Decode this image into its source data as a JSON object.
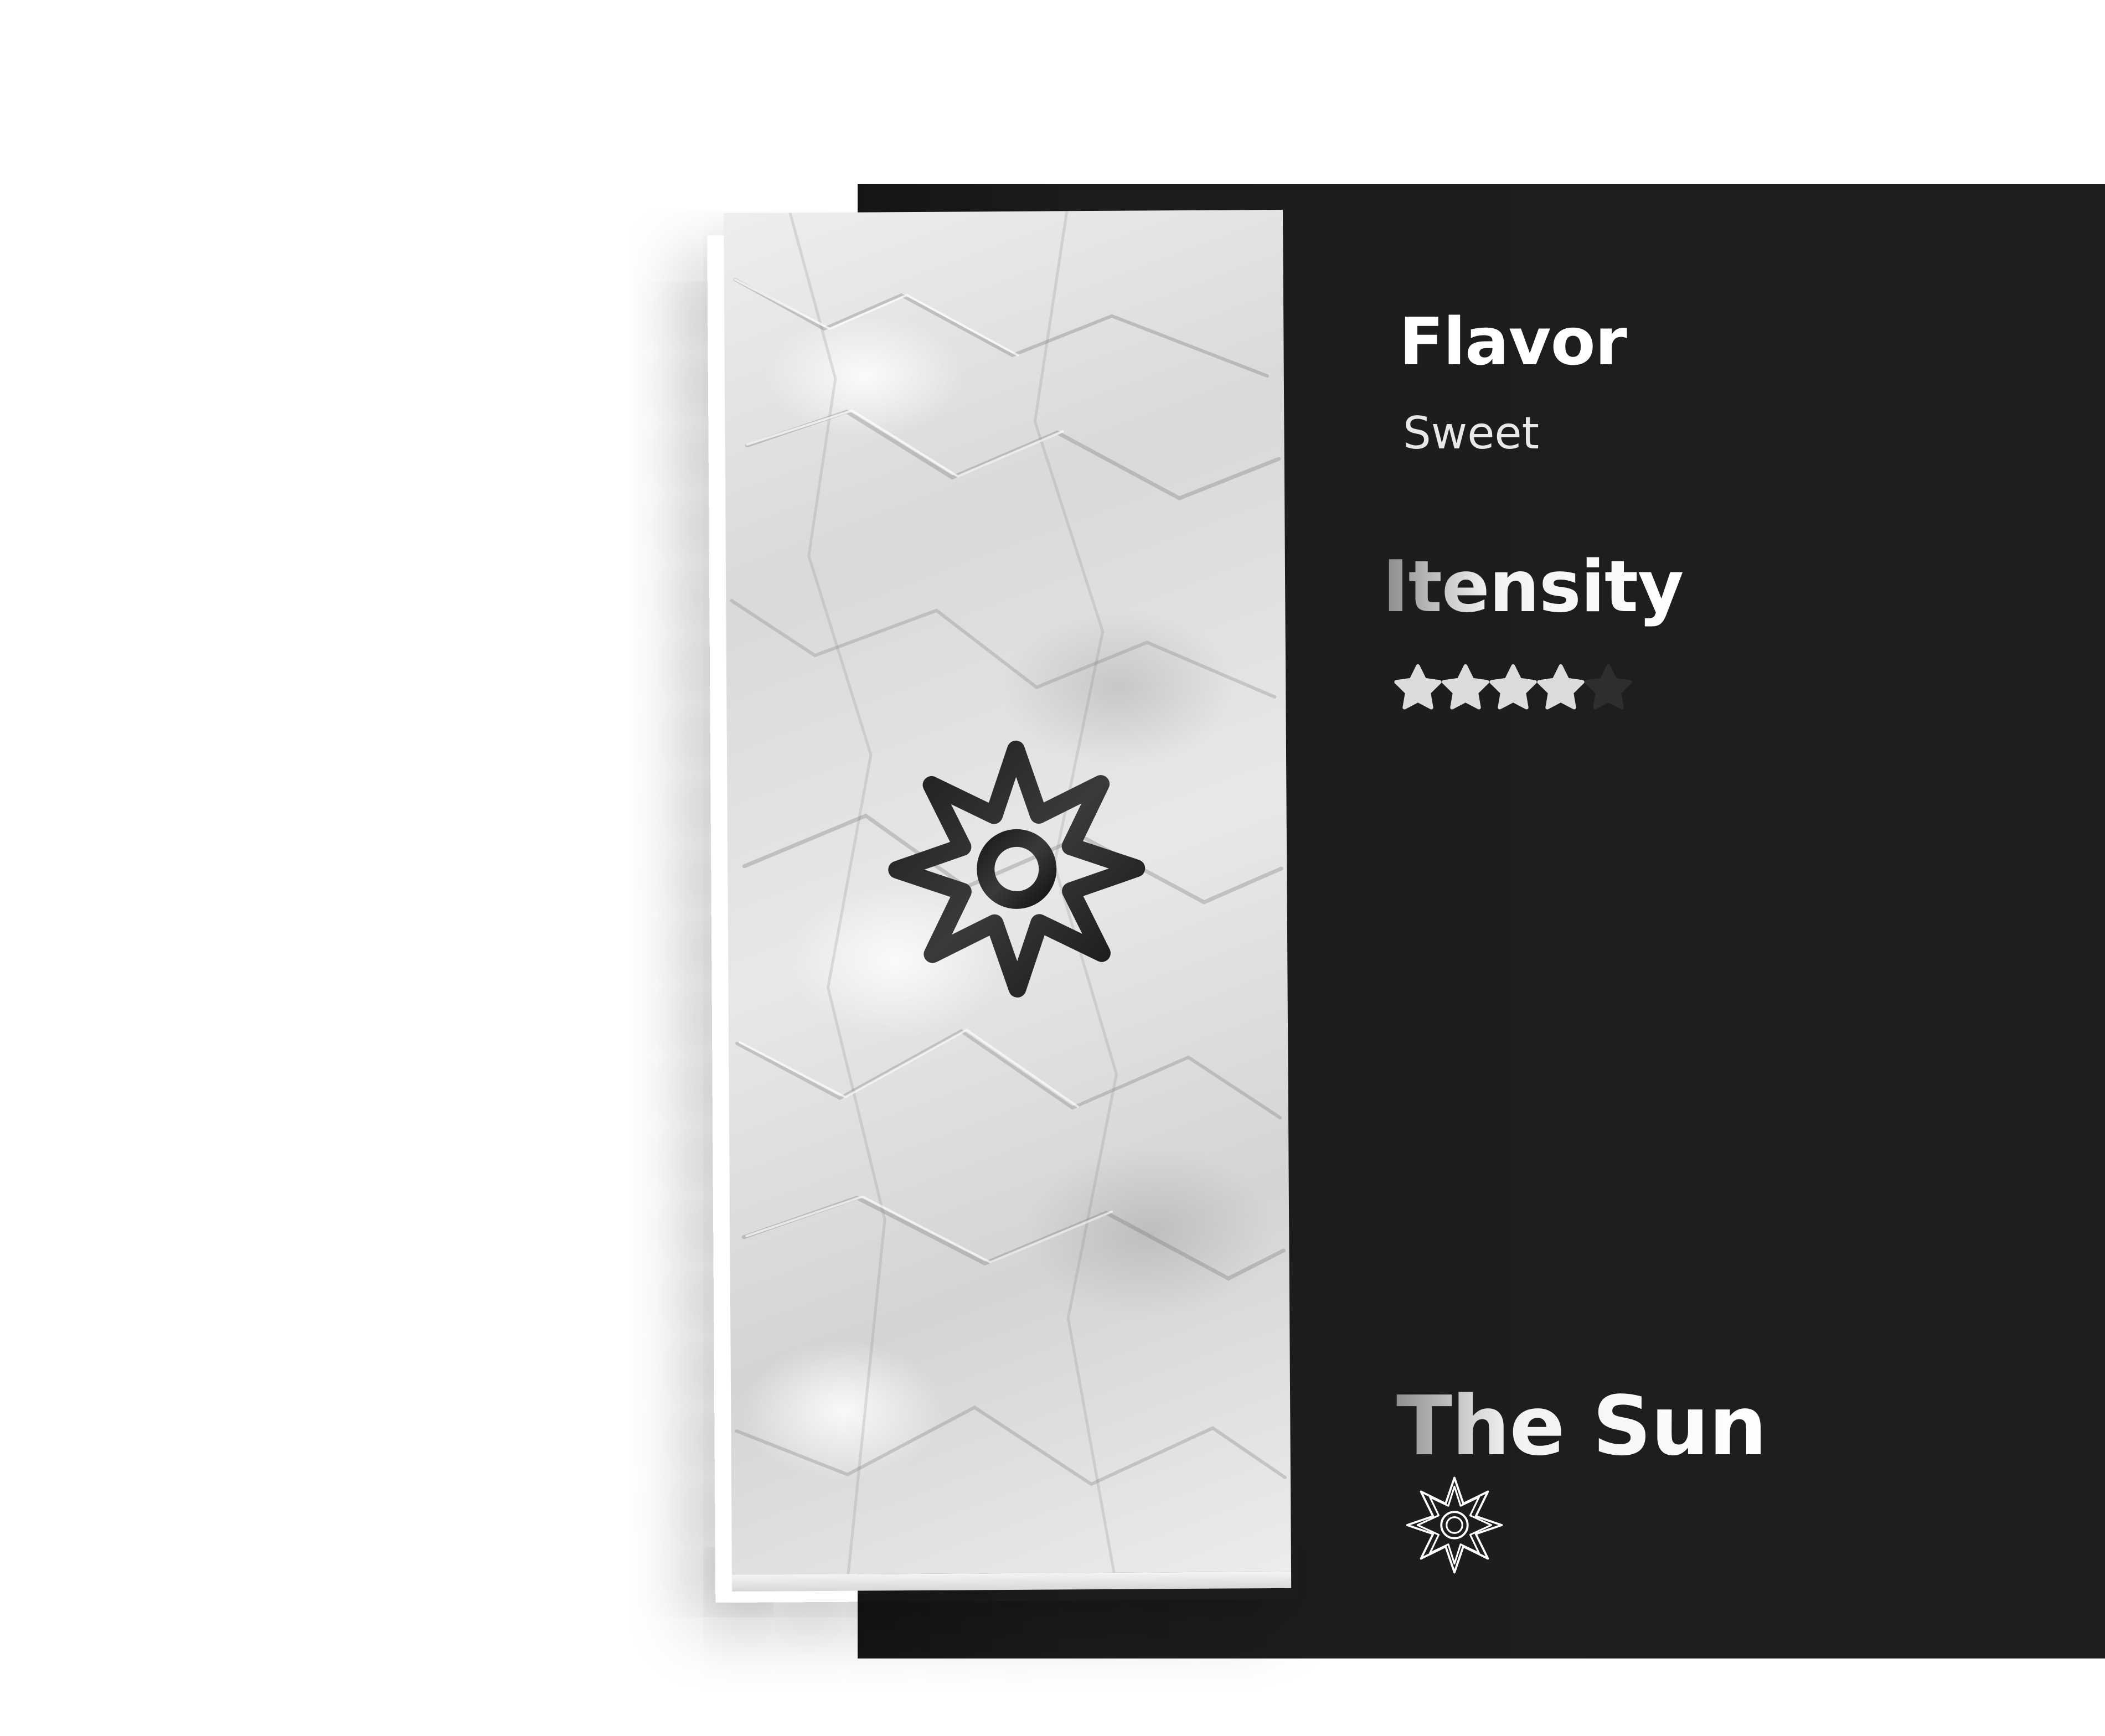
{
  "flavor": {
    "title": "Flavor",
    "value": "Sweet"
  },
  "intensity": {
    "title": "Itensity",
    "rating": 4,
    "max": 5
  },
  "product": {
    "name": "The Sun"
  },
  "icons": {
    "paper_emblem": "sun-star-emblem-icon",
    "name_emblem": "sun-star-emblem-outline-icon",
    "rating": "star-icon"
  },
  "colors": {
    "panel": "#1f1f1f",
    "star_filled": "#dcdcdc",
    "star_empty": "#2e2e2e",
    "text": "#ffffff"
  }
}
